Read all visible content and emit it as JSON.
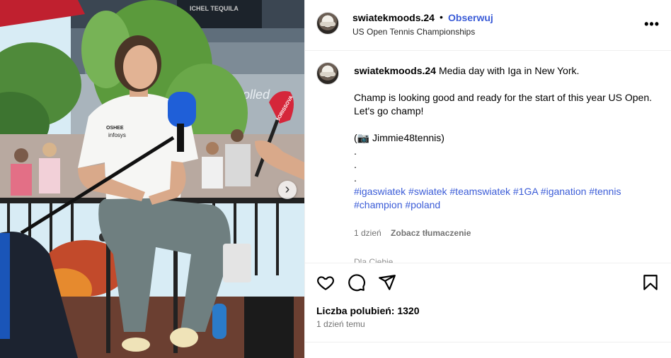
{
  "post": {
    "username": "swiatekmoods.24",
    "separator": "•",
    "follow_label": "Obserwuj",
    "location": "US Open Tennis Championships",
    "more_label": "•••",
    "caption_lines": [
      "Media day with Iga in New York.",
      "",
      "Champ is looking good and ready for the start of this year US Open.",
      "Let's go champ!",
      "",
      "(📷 Jimmie48tennis)",
      ".",
      ".",
      "."
    ],
    "hashtags": "#igaswiatek #swiatek #teamswiatek #1GA #iganation #tennis #champion #poland",
    "comment_time": "1 dzień",
    "translate_label": "Zobacz tłumaczenie",
    "for_you": "Dla Ciebie ⌄",
    "likes": "Liczba polubień: 1320",
    "posted": "1 dzień temu",
    "carousel_next": "›",
    "photo_texts": {
      "banner": "ICHEL TEQUILA",
      "shirt_brand": "OSHEE",
      "shirt_sponsor": "infosys",
      "mic_flag": "BORISSOVA",
      "bg_sign": "Rolled"
    },
    "icons": [
      "heart-icon",
      "comment-icon",
      "share-icon",
      "bookmark-icon"
    ],
    "colors": {
      "link": "#3b5cd7",
      "mic_blue": "#1f5fd8",
      "mic_red": "#d5263a"
    }
  }
}
